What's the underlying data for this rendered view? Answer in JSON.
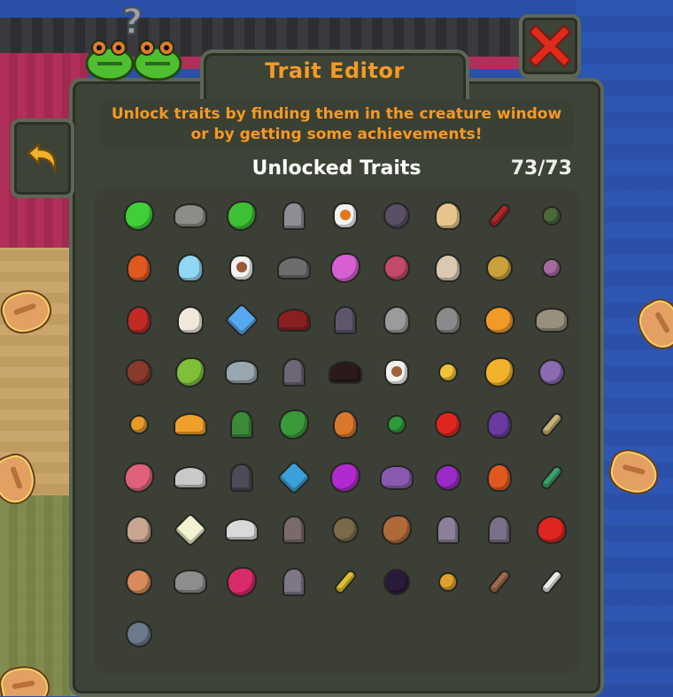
{
  "window": {
    "title": "Trait Editor",
    "description": "Unlock traits by finding them in the creature window or by getting some achievements!",
    "section_title": "Unlocked Traits",
    "count": "73/73"
  },
  "colors": {
    "title_orange": "#f59a23",
    "panel_dark": "#3d4336",
    "panel_border": "#5e6756",
    "close_red": "#e02a1c",
    "back_yellow": "#f2b12c"
  },
  "buttons": {
    "close_icon": "close-x-icon",
    "back_icon": "back-arrow-icon"
  },
  "traits": [
    {
      "icon": "acid-blood-icon",
      "shape": "blob",
      "color": "#3fcf3a"
    },
    {
      "icon": "acid-proof-rock-icon",
      "shape": "rock",
      "color": "#8b8e86"
    },
    {
      "icon": "green-lizard-icon",
      "shape": "blob",
      "color": "#3fbf35"
    },
    {
      "icon": "gray-tombstone-icon",
      "shape": "tomb",
      "color": "#8f8c95"
    },
    {
      "icon": "angry-face-bubble-icon",
      "shape": "bubble",
      "color": "#ffffff",
      "inner": "#e0781a"
    },
    {
      "icon": "dark-orb-icon",
      "shape": "ball",
      "color": "#5b4f66"
    },
    {
      "icon": "blonde-head-icon",
      "shape": "head",
      "color": "#e7c48a"
    },
    {
      "icon": "bloody-knife-icon",
      "shape": "stick",
      "color": "#b3262a"
    },
    {
      "icon": "green-grenade-icon",
      "shape": "small",
      "color": "#4a6a3a"
    },
    {
      "icon": "fire-hands-icon",
      "shape": "flame",
      "color": "#e0571f"
    },
    {
      "icon": "blue-spirit-icon",
      "shape": "head",
      "color": "#8fd7f2"
    },
    {
      "icon": "brain-bubble-icon",
      "shape": "bubble",
      "color": "#ffffff",
      "inner": "#9a5a3a"
    },
    {
      "icon": "gray-wings-icon",
      "shape": "wing",
      "color": "#6d6d6d"
    },
    {
      "icon": "pink-crab-icon",
      "shape": "blob",
      "color": "#d65fd1"
    },
    {
      "icon": "meteor-icon",
      "shape": "ball",
      "color": "#c44a6a"
    },
    {
      "icon": "bone-skull-icon",
      "shape": "head",
      "color": "#d9c9b0"
    },
    {
      "icon": "rainbow-orb-icon",
      "shape": "ball",
      "color": "#c9a13a"
    },
    {
      "icon": "purple-saturn-icon",
      "shape": "small",
      "color": "#a56aa0"
    },
    {
      "icon": "red-demon-icon",
      "shape": "flame",
      "color": "#c22a24"
    },
    {
      "icon": "eagle-head-icon",
      "shape": "head",
      "color": "#f0e9dc"
    },
    {
      "icon": "lightning-icon",
      "shape": "star",
      "color": "#56a8f0"
    },
    {
      "icon": "red-dragon-icon",
      "shape": "wing",
      "color": "#8a1f1f"
    },
    {
      "icon": "purple-orb-tomb-icon",
      "shape": "tomb",
      "color": "#5f566b"
    },
    {
      "icon": "gray-wolf-icon",
      "shape": "head",
      "color": "#9b9b9b"
    },
    {
      "icon": "gray-golem-icon",
      "shape": "head",
      "color": "#8a8a8a"
    },
    {
      "icon": "fire-heart-icon",
      "shape": "heart",
      "color": "#f29a28"
    },
    {
      "icon": "fire-rock-icon",
      "shape": "rock",
      "color": "#9a8f7d"
    },
    {
      "icon": "meat-leg-icon",
      "shape": "ball",
      "color": "#8a3a2a"
    },
    {
      "icon": "green-parrot-icon",
      "shape": "blob",
      "color": "#7fbf3a"
    },
    {
      "icon": "ice-rock-icon",
      "shape": "rock",
      "color": "#9aa6b0"
    },
    {
      "icon": "candle-tomb-icon",
      "shape": "tomb",
      "color": "#6d6677"
    },
    {
      "icon": "black-demon-icon",
      "shape": "wing",
      "color": "#2a1a1a"
    },
    {
      "icon": "meat-bubble-icon",
      "shape": "bubble",
      "color": "#ffffff",
      "inner": "#a0603a"
    },
    {
      "icon": "golden-tooth-icon",
      "shape": "small",
      "color": "#f0c23a"
    },
    {
      "icon": "honeycomb-icon",
      "shape": "blob",
      "color": "#f2b12c"
    },
    {
      "icon": "purple-eye-orb-icon",
      "shape": "ball",
      "color": "#8a6ab0"
    },
    {
      "icon": "golden-scales-icon",
      "shape": "small",
      "color": "#e59a2a"
    },
    {
      "icon": "infinity-icon",
      "shape": "wing",
      "color": "#f0a028"
    },
    {
      "icon": "green-shield-icon",
      "shape": "tomb",
      "color": "#3a8a3a"
    },
    {
      "icon": "green-frog-king-icon",
      "shape": "blob",
      "color": "#3a9a3a"
    },
    {
      "icon": "fox-shield-icon",
      "shape": "flame",
      "color": "#d9782a"
    },
    {
      "icon": "four-leaf-clover-icon",
      "shape": "small",
      "color": "#2f9a3a"
    },
    {
      "icon": "red-eye-icon",
      "shape": "ball",
      "color": "#e0241f"
    },
    {
      "icon": "witch-hat-icon",
      "shape": "flame",
      "color": "#6a3aa0"
    },
    {
      "icon": "pickaxe-icon",
      "shape": "stick",
      "color": "#c9b27a"
    },
    {
      "icon": "pink-mushroom-icon",
      "shape": "blob",
      "color": "#e0607a"
    },
    {
      "icon": "white-bird-icon",
      "shape": "wing",
      "color": "#c9c9c9"
    },
    {
      "icon": "shadow-tomb-icon",
      "shape": "tomb",
      "color": "#4f4a58"
    },
    {
      "icon": "pinwheel-icon",
      "shape": "star",
      "color": "#3aa0d9"
    },
    {
      "icon": "purple-virus-icon",
      "shape": "blob",
      "color": "#b02ad0"
    },
    {
      "icon": "purple-rock-icon",
      "shape": "rock",
      "color": "#8a5ab0"
    },
    {
      "icon": "purple-plum-icon",
      "shape": "ball",
      "color": "#9a2ac9"
    },
    {
      "icon": "campfire-icon",
      "shape": "flame",
      "color": "#e0571f"
    },
    {
      "icon": "green-feather-icon",
      "shape": "stick",
      "color": "#3aa06a"
    },
    {
      "icon": "cat-skull-icon",
      "shape": "head",
      "color": "#c9a690"
    },
    {
      "icon": "sparkles-icon",
      "shape": "star",
      "color": "#f2f2d0"
    },
    {
      "icon": "glasses-icon",
      "shape": "wing",
      "color": "#d9d9d9"
    },
    {
      "icon": "burning-tomb-icon",
      "shape": "tomb",
      "color": "#7a6a6a"
    },
    {
      "icon": "tortoise-icon",
      "shape": "ball",
      "color": "#7a6a4a"
    },
    {
      "icon": "flexed-arm-icon",
      "shape": "blob",
      "color": "#b06a3a"
    },
    {
      "icon": "crowned-tomb-icon",
      "shape": "tomb",
      "color": "#8a8098"
    },
    {
      "icon": "question-tomb-icon",
      "shape": "tomb",
      "color": "#7a7088"
    },
    {
      "icon": "flaming-heart-icon",
      "shape": "heart",
      "color": "#e0241f"
    },
    {
      "icon": "strong-fist-icon",
      "shape": "ball",
      "color": "#d98a5a"
    },
    {
      "icon": "gray-stone-icon",
      "shape": "rock",
      "color": "#8d8d8d"
    },
    {
      "icon": "raspberry-icon",
      "shape": "blob",
      "color": "#d92a6a"
    },
    {
      "icon": "scroll-tomb-icon",
      "shape": "tomb",
      "color": "#7f7788"
    },
    {
      "icon": "banana-peel-icon",
      "shape": "stick",
      "color": "#e0c02a"
    },
    {
      "icon": "monster-mouth-icon",
      "shape": "ball",
      "color": "#2a1a3a"
    },
    {
      "icon": "gold-medal-icon",
      "shape": "small",
      "color": "#e0a02a"
    },
    {
      "icon": "thin-arm-icon",
      "shape": "stick",
      "color": "#a06a4a"
    },
    {
      "icon": "white-feather-icon",
      "shape": "stick",
      "color": "#e9e9e9"
    },
    {
      "icon": "gas-mask-icon",
      "shape": "ball",
      "color": "#6a7a8a"
    }
  ]
}
